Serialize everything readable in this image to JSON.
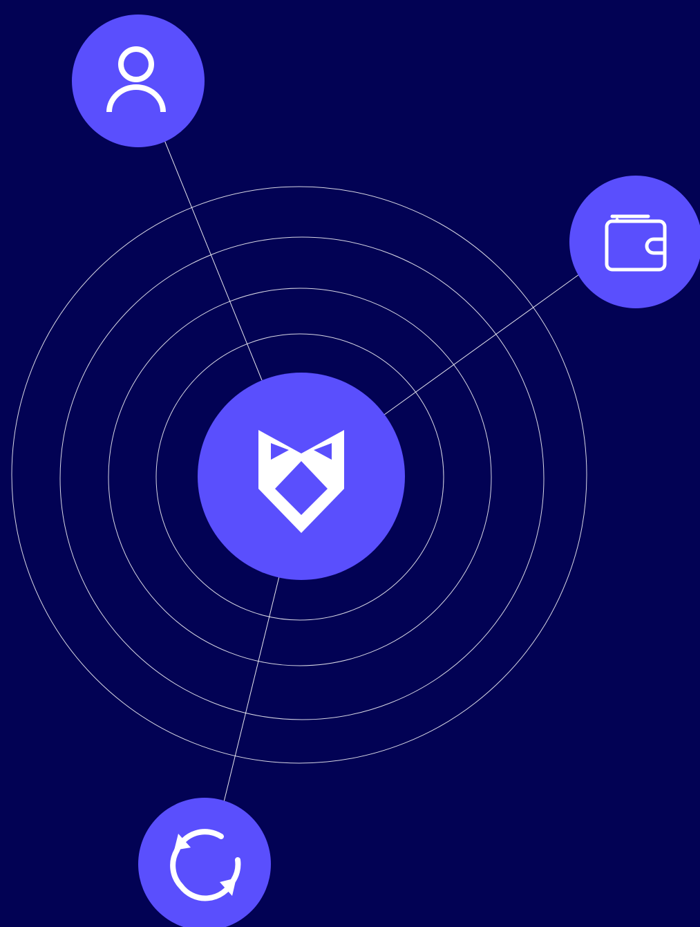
{
  "colors": {
    "background": "#020254",
    "node_fill": "#5a4ffd",
    "line": "#ffffff",
    "icon": "#ffffff"
  },
  "diagram": {
    "center_node": {
      "icon": "fox-shield-logo-icon"
    },
    "satellite_nodes": [
      {
        "icon": "user-icon"
      },
      {
        "icon": "wallet-icon"
      },
      {
        "icon": "refresh-icon"
      }
    ],
    "ring_count": 4
  }
}
